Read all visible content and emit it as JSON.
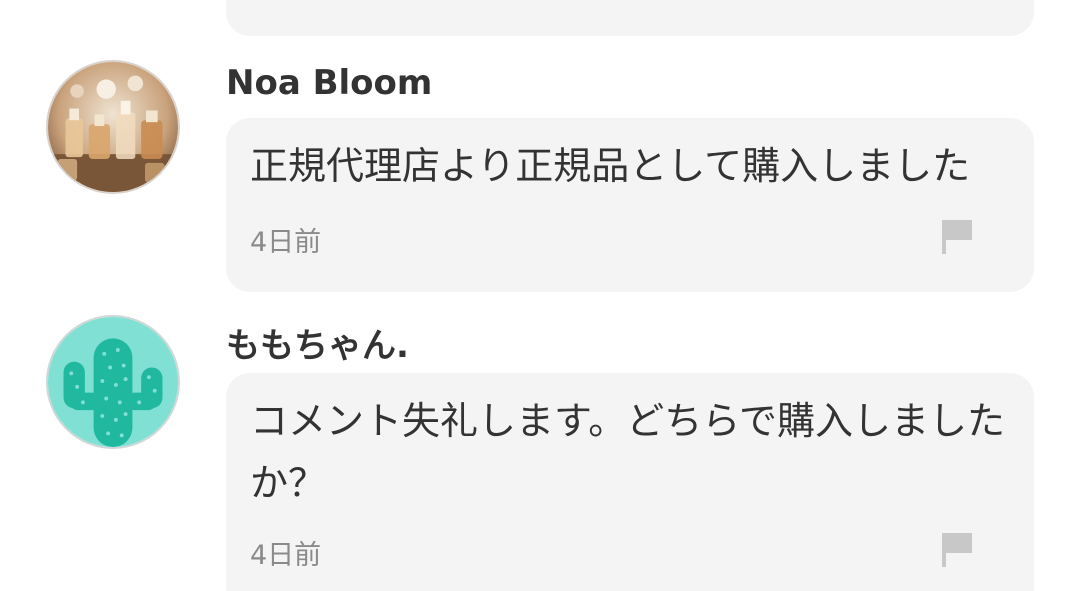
{
  "comments": [
    {
      "author": "Noa Bloom",
      "avatar_icon": "perfume-bottles-photo",
      "body": "正規代理店より正規品として購入しました",
      "time": "4日前",
      "flag_icon": "flag-icon"
    },
    {
      "author": "ももちゃん.",
      "avatar_icon": "cactus-illustration",
      "body": "コメント失礼します。どちらで購入しましたか？",
      "time": "4日前",
      "flag_icon": "flag-icon"
    }
  ],
  "colors": {
    "bubble": "#f4f4f4",
    "text": "#333333",
    "meta": "#8a8a8a",
    "flag": "#c8c8c8",
    "cactus_bg": "#7fe0d3",
    "cactus": "#21b8a0"
  }
}
